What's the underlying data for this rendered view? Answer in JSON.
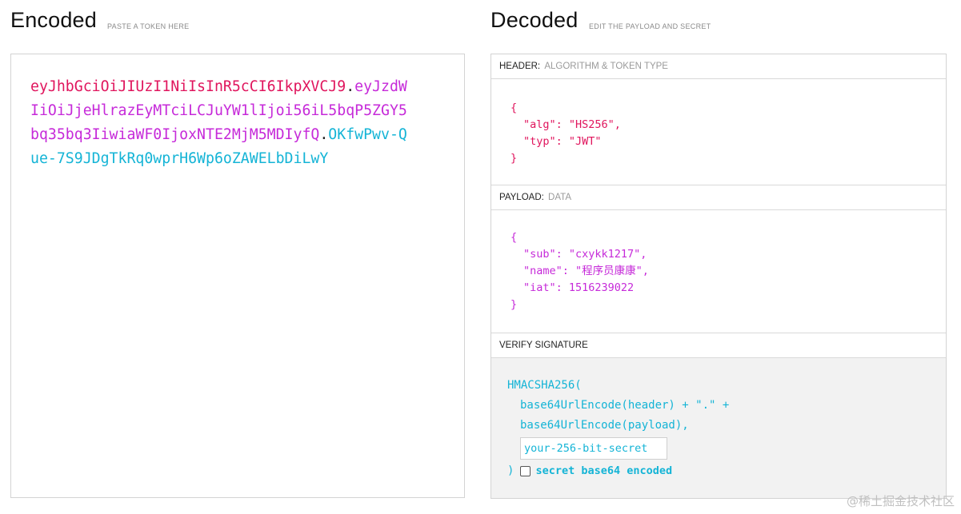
{
  "encoded": {
    "title": "Encoded",
    "subtitle": "PASTE A TOKEN HERE",
    "header_part": "eyJhbGciOiJIUzI1NiIsInR5cCI6IkpXVCJ9",
    "payload_part": "eyJzdWIiOiJjeHlrazEyMTciLCJuYW1lIjoi56iL5bqP5ZGY5bq35bq3IiwiaWF0IjoxNTE2MjM5MDIyfQ",
    "signature_part": "OKfwPwv-Que-7S9JDgTkRq0wprH6Wp6oZAWELbDiLwY",
    "dot": "."
  },
  "decoded": {
    "title": "Decoded",
    "subtitle": "EDIT THE PAYLOAD AND SECRET",
    "header_section": {
      "label": "HEADER:",
      "sublabel": "ALGORITHM & TOKEN TYPE",
      "lines": [
        "{",
        "\"alg\": \"HS256\",",
        "\"typ\": \"JWT\"",
        "}"
      ]
    },
    "payload_section": {
      "label": "PAYLOAD:",
      "sublabel": "DATA",
      "lines": [
        "{",
        "\"sub\": \"cxykk1217\",",
        "\"name\": \"程序员康康\",",
        "\"iat\": 1516239022",
        "}"
      ]
    },
    "signature_section": {
      "label": "VERIFY SIGNATURE",
      "func_open": "HMACSHA256(",
      "arg1": "base64UrlEncode(header) + \".\" +",
      "arg2": "base64UrlEncode(payload),",
      "secret_value": "your-256-bit-secret",
      "close": ")",
      "checkbox_label": "secret base64 encoded",
      "checkbox_checked": false
    }
  },
  "watermark": "@稀土掘金技术社区",
  "colors": {
    "header": "#e0155d",
    "payload": "#c62ad9",
    "signature": "#14b4d6"
  }
}
